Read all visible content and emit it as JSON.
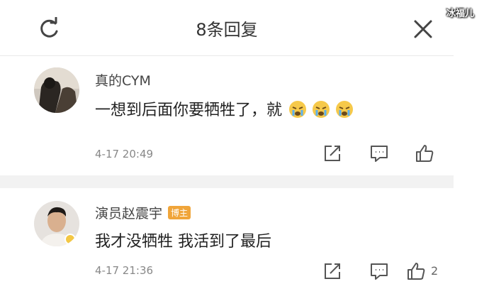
{
  "header": {
    "title": "8条回复"
  },
  "watermark": "冰福儿",
  "comments": [
    {
      "username": "真的CYM",
      "text": "一想到后面你要牺牲了，就",
      "emoji_count": 3,
      "emoji": "crying-face",
      "time": "4-17 20:49",
      "likes": ""
    },
    {
      "username": "演员赵震宇",
      "badge": "博主",
      "text": "我才没牺牲  我活到了最后",
      "time": "4-17 21:36",
      "likes": "2"
    }
  ],
  "colors": {
    "text": "#222222",
    "secondary": "#888888",
    "badge": "#f0a53a",
    "divider": "#f2f2f2"
  }
}
